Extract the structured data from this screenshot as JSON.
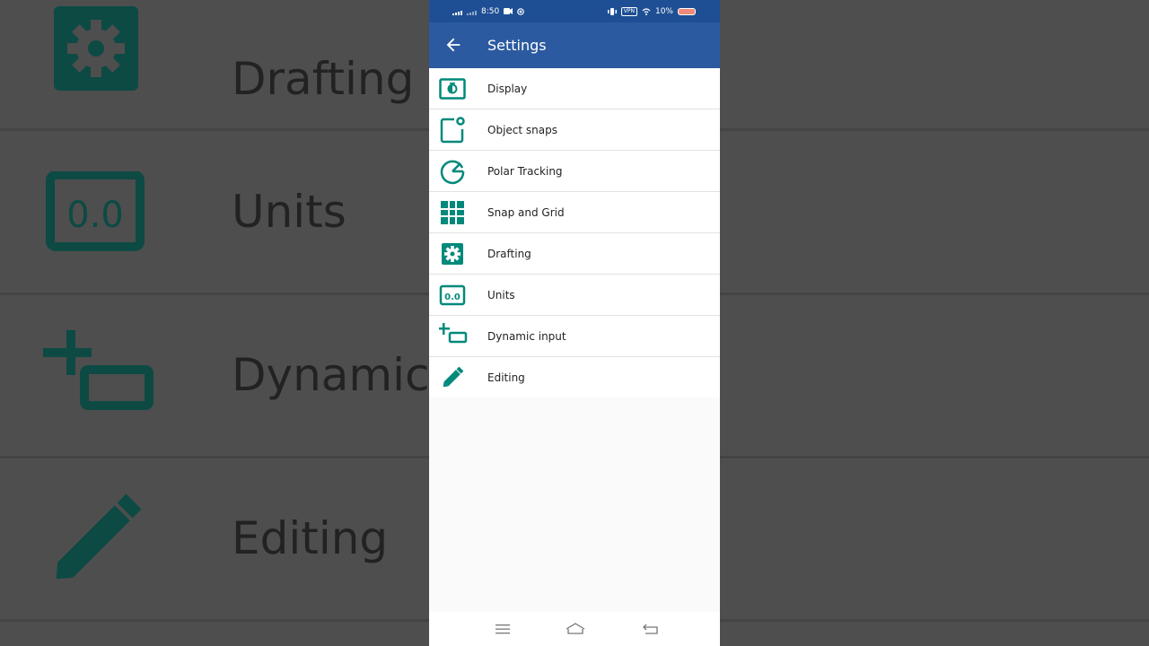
{
  "background": {
    "rows": [
      {
        "label": "Drafting",
        "icon": "gear-icon"
      },
      {
        "label": "Units",
        "icon": "units-icon"
      },
      {
        "label": "Dynamic in",
        "icon": "dynamic-input-icon"
      },
      {
        "label": "Editing",
        "icon": "pencil-icon"
      }
    ]
  },
  "status_bar": {
    "time": "8:50",
    "vpn": "VPN",
    "battery": "10%"
  },
  "app_bar": {
    "title": "Settings",
    "back_icon": "arrow-back-icon"
  },
  "settings": {
    "items": [
      {
        "label": "Display",
        "icon": "display-icon"
      },
      {
        "label": "Object snaps",
        "icon": "object-snaps-icon"
      },
      {
        "label": "Polar Tracking",
        "icon": "polar-tracking-icon"
      },
      {
        "label": "Snap and Grid",
        "icon": "grid-icon"
      },
      {
        "label": "Drafting",
        "icon": "gear-icon"
      },
      {
        "label": "Units",
        "icon": "units-icon"
      },
      {
        "label": "Dynamic input",
        "icon": "dynamic-input-icon"
      },
      {
        "label": "Editing",
        "icon": "pencil-icon"
      }
    ]
  },
  "units_icon_text": "0.0",
  "colors": {
    "accent": "#00897b",
    "app_bar": "#2c5aa0",
    "status_bar": "#1e4f94"
  },
  "nav_bar": {
    "icons": [
      "menu-icon",
      "home-icon",
      "back-nav-icon"
    ]
  }
}
